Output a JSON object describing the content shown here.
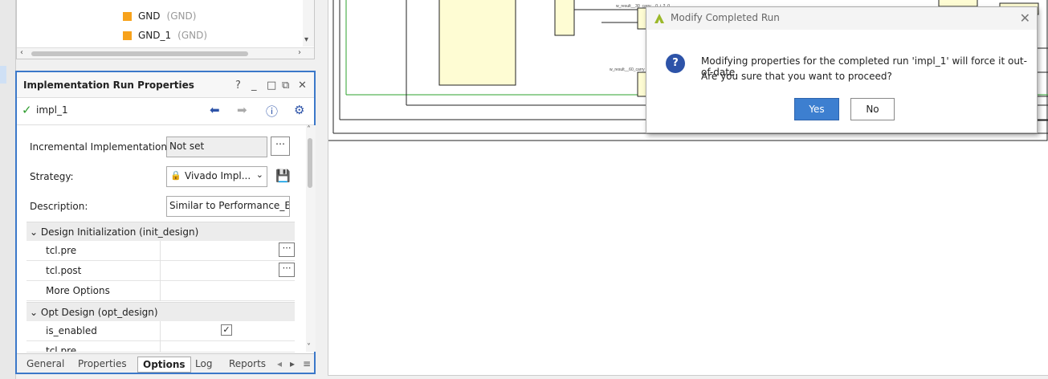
{
  "tree": {
    "items": [
      {
        "name": "GND",
        "sub": "(GND)"
      },
      {
        "name": "GND_1",
        "sub": "(GND)"
      }
    ]
  },
  "panel": {
    "title": "Implementation Run Properties",
    "run_name": "impl_1",
    "fields": {
      "incremental_label": "Incremental Implementation:",
      "incremental_value": "Not set",
      "strategy_label": "Strategy:",
      "strategy_value": "Vivado Impl...",
      "description_label": "Description:",
      "description_value": "Similar to Performance_Ex"
    },
    "sections": [
      {
        "title": "Design Initialization (init_design)",
        "rows": [
          "tcl.pre",
          "tcl.post",
          "More Options"
        ]
      },
      {
        "title": "Opt Design (opt_design)",
        "rows": [
          "is_enabled",
          "tcl.pre"
        ]
      }
    ],
    "tabs": [
      "General",
      "Properties",
      "Options",
      "Log",
      "Reports"
    ],
    "active_tab": "Options"
  },
  "dialog": {
    "title": "Modify Completed Run",
    "message_line1": "Modifying properties for the completed run 'impl_1' will force it out-of-date.",
    "message_line2": "Are you sure that you want to proceed?",
    "yes_label": "Yes",
    "no_label": "No"
  },
  "schematic": {
    "net_label_1": "w_result__30_carry__0_i_2_0",
    "net_label_2": "w_result__60_carry"
  },
  "colors": {
    "accent": "#3b78c9",
    "yes_button": "#3d7fd0",
    "cell_fill": "#fefcd3",
    "check": "#2e9c2e",
    "gnd_square": "#f7a21b"
  }
}
